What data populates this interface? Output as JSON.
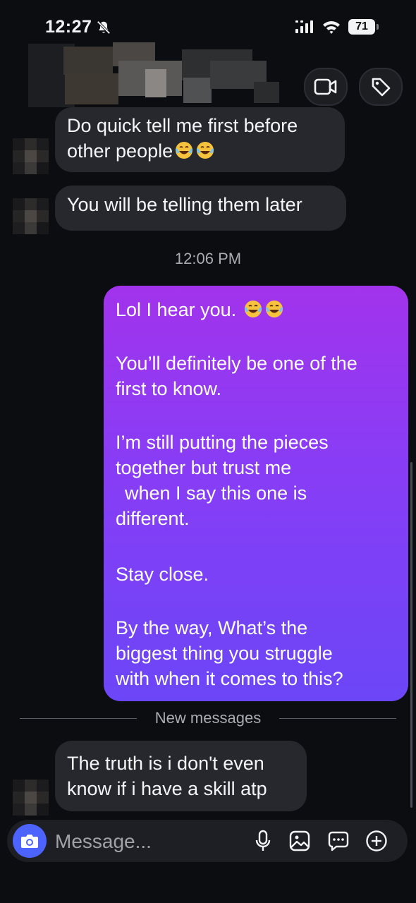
{
  "status_bar": {
    "time": "12:27",
    "battery": "71",
    "icons": [
      "bell-slash-icon",
      "cellular-signal-icon",
      "wifi-icon",
      "battery-icon"
    ]
  },
  "header": {
    "actions": [
      {
        "name": "video-call",
        "icon": "video-camera-icon"
      },
      {
        "name": "tag",
        "icon": "tag-icon"
      }
    ]
  },
  "messages": {
    "incoming_1": {
      "line1": "Do quick tell me first before",
      "line2": "other people"
    },
    "incoming_2": {
      "text": "You will be telling them later"
    },
    "timestamp": "12:06 PM",
    "outgoing": {
      "p1": "Lol I hear you.",
      "p2": [
        "You’ll definitely be one of the",
        "first to know."
      ],
      "p3": [
        "I’m still putting the pieces",
        "together but trust me",
        "when I say this one is",
        "different."
      ],
      "p4": "Stay close.",
      "p5": [
        "By the way, What’s the",
        "biggest thing you struggle",
        "with when it comes to this?"
      ]
    },
    "divider_label": "New messages",
    "incoming_3": {
      "line1": "The truth is i don't even",
      "line2": "know if i have a skill atp"
    }
  },
  "composer": {
    "placeholder": "Message...",
    "tools": [
      "microphone-icon",
      "gallery-icon",
      "sticker-chat-icon",
      "plus-circle-icon"
    ]
  },
  "colors": {
    "background": "#0c0d10",
    "incoming_bubble": "#26282d",
    "outgoing_gradient_top": "#a233ec",
    "outgoing_gradient_bottom": "#6b46f7",
    "camera_button": "#4c63ff"
  }
}
